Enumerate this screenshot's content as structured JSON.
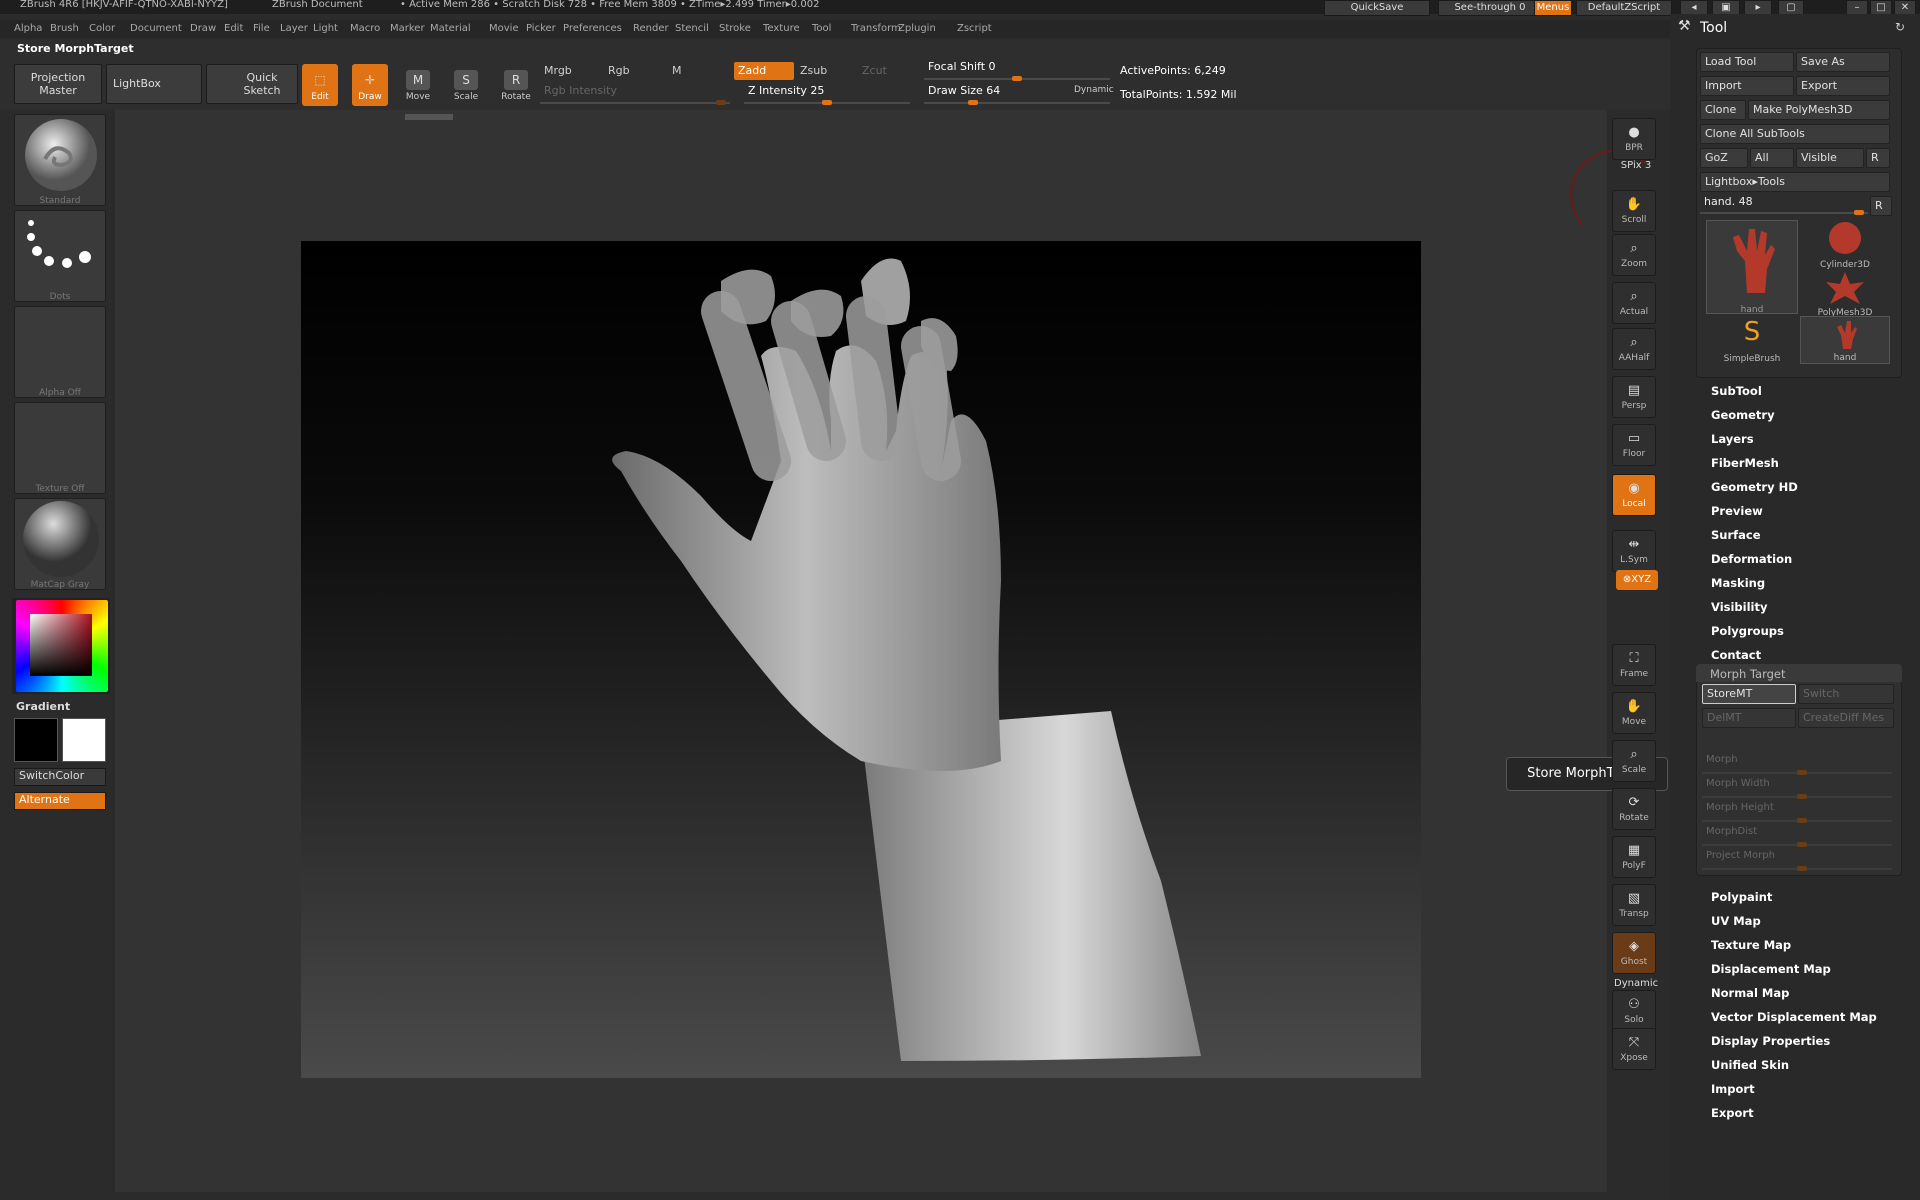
{
  "title_bar": {
    "app": "ZBrush 4R6 [HKJV-AFIF-QTNO-XABI-NYYZ]",
    "document": "ZBrush Document",
    "stats": "• Active Mem 286 • Scratch Disk 728 • Free Mem 3809 • ZTime▸2.499 Timer▸0.002",
    "quicksave": "QuickSave",
    "see_through": "See-through  0",
    "menus": "Menus",
    "script": "DefaultZScript"
  },
  "menu": [
    "Alpha",
    "Brush",
    "Color",
    "Document",
    "Draw",
    "Edit",
    "File",
    "Layer",
    "Light",
    "Macro",
    "Marker",
    "Material",
    "Movie",
    "Picker",
    "Preferences",
    "Render",
    "Stencil",
    "Stroke",
    "Texture",
    "Tool",
    "Transform",
    "Zplugin",
    "Zscript"
  ],
  "toolbar": {
    "current_action": "Store MorphTarget",
    "projection_master": "Projection Master",
    "lightbox": "LightBox",
    "quick_sketch": "Quick Sketch",
    "edit": "Edit",
    "draw": "Draw",
    "move": "Move",
    "scale": "Scale",
    "rotate": "Rotate",
    "mrgb": "Mrgb",
    "rgb": "Rgb",
    "m": "M",
    "zadd": "Zadd",
    "zsub": "Zsub",
    "zcut": "Zcut",
    "rgb_intensity": "Rgb Intensity",
    "z_intensity": "Z Intensity 25",
    "focal_shift": "Focal Shift 0",
    "draw_size": "Draw Size 64",
    "dynamic": "Dynamic",
    "active_points": "ActivePoints: 6,249",
    "total_points": "TotalPoints: 1.592 Mil"
  },
  "left_shelf": {
    "brush": "Standard",
    "stroke": "Dots",
    "alpha": "Alpha Off",
    "texture": "Texture Off",
    "material": "MatCap Gray",
    "gradient": "Gradient",
    "switch_color": "SwitchColor",
    "alternate": "Alternate"
  },
  "right_tray": [
    {
      "id": "bpr",
      "label": "BPR"
    },
    {
      "id": "spix",
      "label": "SPix 3"
    },
    {
      "id": "scroll",
      "label": "Scroll"
    },
    {
      "id": "zoom",
      "label": "Zoom"
    },
    {
      "id": "actual",
      "label": "Actual"
    },
    {
      "id": "aahalf",
      "label": "AAHalf"
    },
    {
      "id": "persp",
      "label": "Persp"
    },
    {
      "id": "floor",
      "label": "Floor"
    },
    {
      "id": "local",
      "label": "Local"
    },
    {
      "id": "lsym",
      "label": "L.Sym"
    },
    {
      "id": "xyz",
      "label": "⊗XYZ"
    },
    {
      "id": "frame",
      "label": "Frame"
    },
    {
      "id": "move",
      "label": "Move"
    },
    {
      "id": "scale",
      "label": "Scale"
    },
    {
      "id": "rotate",
      "label": "Rotate"
    },
    {
      "id": "polyf",
      "label": "PolyF"
    },
    {
      "id": "transp",
      "label": "Transp"
    },
    {
      "id": "ghost",
      "label": "Ghost"
    },
    {
      "id": "dynamic",
      "label": "Dynamic"
    },
    {
      "id": "solo",
      "label": "Solo"
    },
    {
      "id": "xpose",
      "label": "Xpose"
    }
  ],
  "tooltip": "Store MorphTarget",
  "tool_panel": {
    "header": "Tool",
    "load_tool": "Load Tool",
    "save_as": "Save As",
    "import": "Import",
    "export": "Export",
    "clone": "Clone",
    "make_polymesh": "Make PolyMesh3D",
    "clone_all": "Clone All SubTools",
    "goz": "GoZ",
    "all": "All",
    "visible": "Visible",
    "r": "R",
    "lightbox_tools": "Lightbox▸Tools",
    "current_tool": "hand. 48",
    "thumbs": [
      "hand",
      "Cylinder3D",
      "PolyMesh3D",
      "SimpleBrush",
      "hand"
    ],
    "sections_top": [
      "SubTool",
      "Geometry",
      "Layers",
      "FiberMesh",
      "Geometry HD",
      "Preview",
      "Surface",
      "Deformation",
      "Masking",
      "Visibility",
      "Polygroups",
      "Contact"
    ],
    "morph_target": "Morph Target",
    "store_mt": "StoreMT",
    "switch": "Switch",
    "del_mt": "DelMT",
    "create_diff": "CreateDiff Mes",
    "morph_sliders": [
      "Morph",
      "Morph Width",
      "Morph Height",
      "MorphDist",
      "Project Morph"
    ],
    "sections_bottom": [
      "Polypaint",
      "UV Map",
      "Texture Map",
      "Displacement Map",
      "Normal Map",
      "Vector Displacement Map",
      "Display Properties",
      "Unified Skin",
      "Import",
      "Export"
    ]
  }
}
